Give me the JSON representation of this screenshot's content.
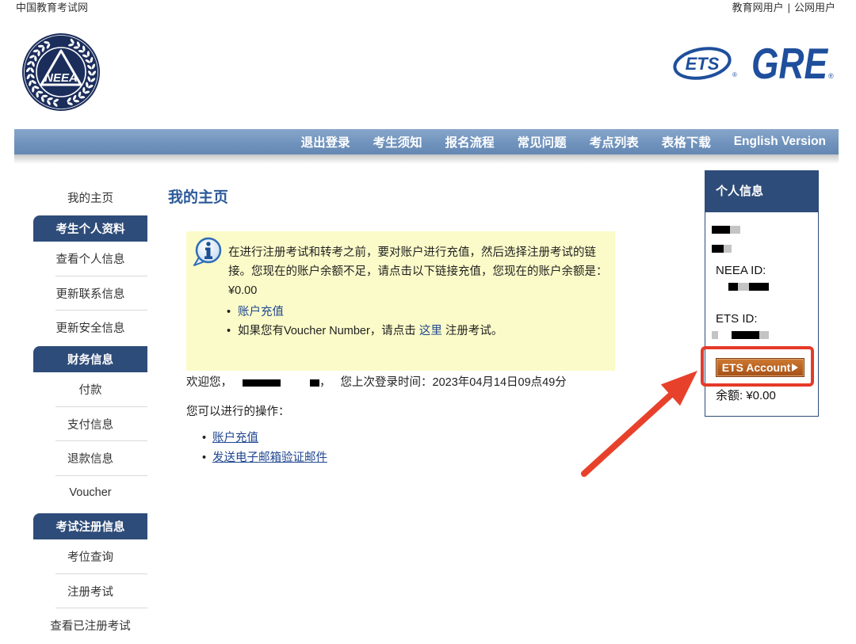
{
  "site": {
    "name": "中国教育考试网",
    "user_links": [
      "教育网用户",
      "公网用户"
    ],
    "separator": "|"
  },
  "logos": {
    "neea": "NEEA",
    "ets": "ETS",
    "gre": "GRE",
    "registered_mark": "®"
  },
  "nav": {
    "items": [
      "退出登录",
      "考生须知",
      "报名流程",
      "常见问题",
      "考点列表",
      "表格下载",
      "English Version"
    ]
  },
  "sidebar": {
    "home": "我的主页",
    "sections": [
      {
        "title": "考生个人资料",
        "items": [
          "查看个人信息",
          "更新联系信息",
          "更新安全信息"
        ]
      },
      {
        "title": "财务信息",
        "items": [
          "付款",
          "支付信息",
          "退款信息",
          "Voucher"
        ]
      },
      {
        "title": "考试注册信息",
        "items": [
          "考位查询",
          "注册考试",
          "查看已注册考试"
        ]
      }
    ]
  },
  "main": {
    "title": "我的主页",
    "notice": {
      "text": "在进行注册考试和转考之前，要对账户进行充值，然后选择注册考试的链接。您现在的账户余额不足，请点击以下链接充值，您现在的账户余额是：",
      "balance": "¥0.00",
      "recharge_link": "账户充值",
      "voucher_prefix": "如果您有Voucher Number，请点击 ",
      "voucher_link": "这里",
      "voucher_suffix": " 注册考试。"
    },
    "welcome": {
      "prefix": "欢迎您，",
      "suffix": "，",
      "last_login": "您上次登录时间：2023年04月14日09点49分"
    },
    "actions_label": "您可以进行的操作：",
    "actions": [
      "账户充值",
      "发送电子邮箱验证邮件"
    ]
  },
  "profile": {
    "title": "个人信息",
    "neea_id_label": "NEEA ID:",
    "ets_id_label": "ETS ID:",
    "ets_account_button": "ETS Account",
    "balance": "余额: ¥0.00"
  },
  "icons": {
    "notice": "info-icon",
    "ets_account_button": "triangle-right-icon",
    "annotation": "arrow-icon"
  },
  "colors": {
    "nav_bar": "#7093bd",
    "sidebar_header": "#2e4c79",
    "title": "#2b5a98",
    "notice_bg": "#fbfbc9",
    "link": "#1f4690",
    "button": "#b65f1e",
    "highlight": "#e53a29",
    "arrow": "#e8412b",
    "logo_blue": "#1f4f9c",
    "logo_navy": "#1b2d5b"
  }
}
